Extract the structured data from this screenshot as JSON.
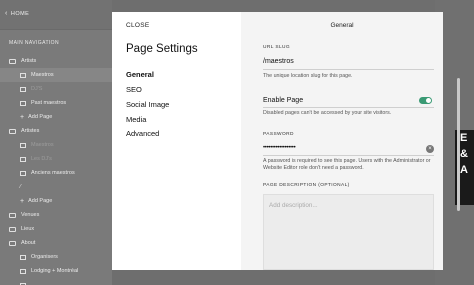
{
  "background": {
    "home_label": "HOME",
    "nav_title": "MAIN NAVIGATION",
    "rows": [
      {
        "label": "Artists",
        "type": "folder",
        "indent": 0,
        "selected": false,
        "dim": false
      },
      {
        "label": "Maestros",
        "type": "page",
        "indent": 1,
        "selected": true,
        "dim": false
      },
      {
        "label": "DJ'S",
        "type": "page",
        "indent": 1,
        "selected": false,
        "dim": true
      },
      {
        "label": "Past maestros",
        "type": "page",
        "indent": 1,
        "selected": false,
        "dim": false
      },
      {
        "label": "Add Page",
        "type": "add",
        "indent": 1,
        "selected": false,
        "dim": false
      },
      {
        "label": "Artistes",
        "type": "folder",
        "indent": 0,
        "selected": false,
        "dim": false
      },
      {
        "label": "Maestros",
        "type": "page",
        "indent": 1,
        "selected": false,
        "dim": true
      },
      {
        "label": "Les DJ's",
        "type": "page",
        "indent": 1,
        "selected": false,
        "dim": true
      },
      {
        "label": "Anciens maestros",
        "type": "page",
        "indent": 1,
        "selected": false,
        "dim": false
      },
      {
        "label": "",
        "type": "link",
        "indent": 1,
        "selected": false,
        "dim": false
      },
      {
        "label": "Add Page",
        "type": "add",
        "indent": 1,
        "selected": false,
        "dim": false
      },
      {
        "label": "Venues",
        "type": "folder",
        "indent": 0,
        "selected": false,
        "dim": false
      },
      {
        "label": "Lieux",
        "type": "folder",
        "indent": 0,
        "selected": false,
        "dim": false
      },
      {
        "label": "About",
        "type": "folder",
        "indent": 0,
        "selected": false,
        "dim": false
      },
      {
        "label": "Organisers",
        "type": "page",
        "indent": 1,
        "selected": false,
        "dim": false
      },
      {
        "label": "Lodging + Montréal",
        "type": "page",
        "indent": 1,
        "selected": false,
        "dim": false
      },
      {
        "label": "",
        "type": "page",
        "indent": 1,
        "selected": false,
        "dim": false
      }
    ],
    "right_block_text": "E\n&\nA"
  },
  "modal": {
    "close_label": "CLOSE",
    "title": "Page Settings",
    "nav": [
      {
        "label": "General",
        "active": true
      },
      {
        "label": "SEO",
        "active": false
      },
      {
        "label": "Social Image",
        "active": false
      },
      {
        "label": "Media",
        "active": false
      },
      {
        "label": "Advanced",
        "active": false
      }
    ],
    "panel_title": "General",
    "url_slug": {
      "label": "URL SLUG",
      "value": "/maestros",
      "help": "The unique location slug for this page."
    },
    "enable_page": {
      "label": "Enable Page",
      "enabled": true,
      "help": "Disabled pages can't be accessed by your site visitors."
    },
    "password": {
      "label": "PASSWORD",
      "value": "••••••••••••••••••",
      "help": "A password is required to see this page. Users with the Administrator or Website Editor role don't need a password."
    },
    "description": {
      "label": "PAGE DESCRIPTION (OPTIONAL)",
      "placeholder": "Add description..."
    }
  },
  "colors": {
    "toggle_on": "#3a9a74",
    "overlay": "#6e6e6e"
  }
}
